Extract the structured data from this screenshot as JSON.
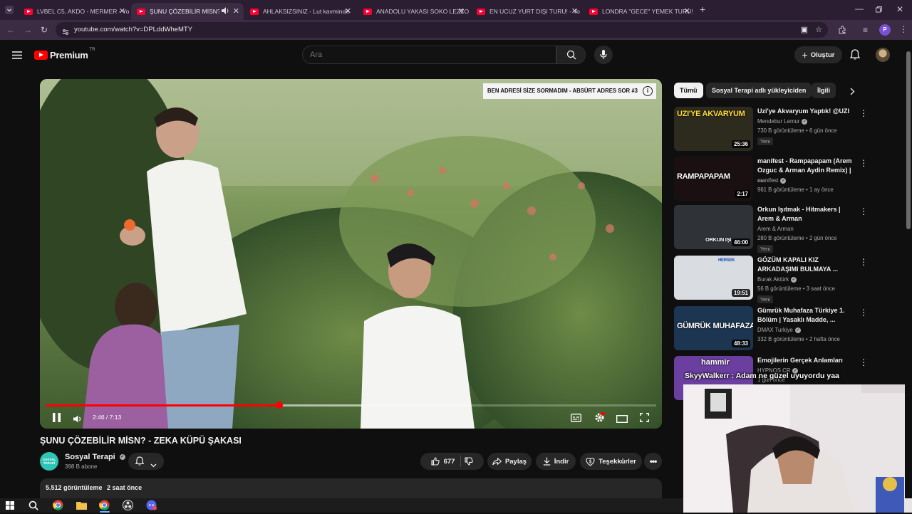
{
  "browser": {
    "tabs": [
      {
        "title": "LVBEL C5, AKDO - MERMER - Yo",
        "active": false
      },
      {
        "title": "ŞUNU ÇÖZEBİLİR MİSN? - Z",
        "active": true
      },
      {
        "title": "AHLAKSIZSINIZ - Lut kavminde",
        "active": false
      },
      {
        "title": "ANADOLU YAKASI SOKO LEZZO",
        "active": false
      },
      {
        "title": "EN UCUZ YURT DIŞI TURU! - Yo",
        "active": false
      },
      {
        "title": "LONDRA \"GECE\" YEMEK TURU!",
        "active": false
      }
    ],
    "url": "youtube.com/watch?v=DPLddWheMTY",
    "profile_initial": "P"
  },
  "youtube": {
    "logo_text": "Premium",
    "logo_region": "TR",
    "search_placeholder": "Ara",
    "create_label": "Oluştur"
  },
  "video": {
    "endscreen_chip": "BEN ADRESİ SİZE SORMADIM - ABSÜRT ADRES SOR #3",
    "time_text": "2:46 / 7:13",
    "progress_played": 0.3833,
    "progress_loaded": 0.52,
    "title": "ŞUNU ÇÖZEBİLİR MİSN? - ZEKA KÜPÜ ŞAKASI",
    "channel_name": "Sosyal Terapi",
    "channel_avatar_text": "SOSYAL TERAPİ",
    "subscribers": "398 B abone",
    "likes": "677",
    "share_label": "Paylaş",
    "download_label": "İndir",
    "thanks_label": "Teşekkürler",
    "views": "5.512 görüntüleme",
    "uploaded": "2 saat önce"
  },
  "chips": [
    "Tümü",
    "Sosyal Terapi adlı yükleyiciden",
    "İlgili"
  ],
  "recommendations": [
    {
      "title": "Uzi'ye Akvaryum Yaptık! @UZI",
      "channel": "Mendebur Lemur",
      "verified": true,
      "meta": "730 B görüntüleme • 6 gün önce",
      "badge": "Yeni",
      "duration": "25:36",
      "thumb_text": "UZI'YE AKVARYUM",
      "thumb_color": "#2d2a1e"
    },
    {
      "title": "manifest - Rampapapam (Arem Ozguc & Arman Aydin Remix) | ...",
      "channel": "manifest",
      "verified": true,
      "meta": "961 B görüntüleme • 1 ay önce",
      "badge": "",
      "duration": "2:17",
      "thumb_text": "RAMPAPAPAM",
      "thumb_color": "#1a1012"
    },
    {
      "title": "Orkun Işıtmak - Hitmakers | Arem & Arman",
      "channel": "Arem & Arman",
      "verified": false,
      "meta": "280 B görüntüleme • 2 gün önce",
      "badge": "Yeni",
      "duration": "46:00",
      "thumb_text": "ORKUN IŞI",
      "thumb_color": "#2f3338"
    },
    {
      "title": "GÖZÜM KAPALI KIZ ARKADAŞIMI BULMAYA ...",
      "channel": "Burak Aktürk",
      "verified": true,
      "meta": "56 B görüntüleme • 3 saat önce",
      "badge": "Yeni",
      "duration": "19:51",
      "thumb_text": "HERSEK",
      "thumb_color": "#d9dde2"
    },
    {
      "title": "Gümrük Muhafaza Türkiye 1. Bölüm | Yasaklı Madde, ...",
      "channel": "DMAX Turkiye",
      "verified": true,
      "meta": "332 B görüntüleme • 2 hafta önce",
      "badge": "",
      "duration": "48:33",
      "thumb_text": "GÜMRÜK MUHAFAZA",
      "thumb_color": "#1c3550"
    },
    {
      "title": "Emojilerin Gerçek Anlamları",
      "channel": "HYPNOS CR",
      "verified": true,
      "meta": "1 gün önce",
      "badge": "",
      "duration": "",
      "thumb_text": "",
      "thumb_color": "#6b3fa0"
    }
  ],
  "overlay": {
    "chat_user": "hammir",
    "chat_line": "SkyyWalkerr : Adam ne güzel uyuyordu yaa"
  },
  "colors": {
    "accent_red": "#ff0000",
    "tab_bg": "#2b1d32",
    "toolbar_bg": "#3b2b43"
  }
}
